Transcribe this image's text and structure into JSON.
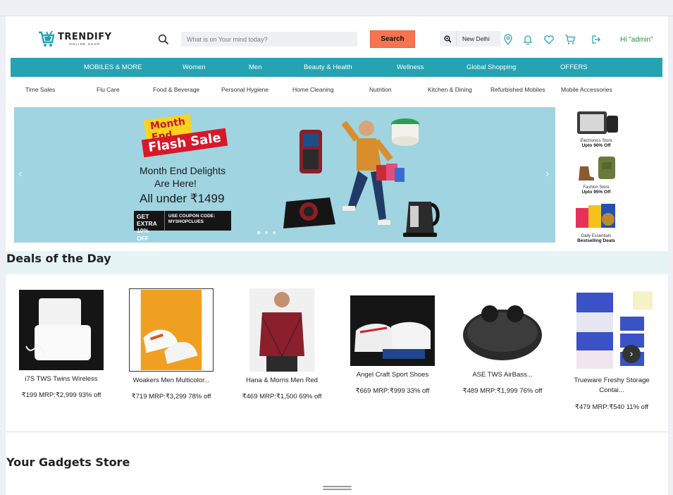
{
  "header": {
    "brand": "TRENDIFY",
    "brand_tagline": "ONLINE SHOP",
    "search_placeholder": "What is on Your mind today?",
    "search_button": "Search",
    "location": "New Delhi",
    "greeting": "Hi \"admin\""
  },
  "nav": {
    "items": [
      "MOBILES & MORE",
      "Women",
      "Men",
      "Beauty & Health",
      "Wellness",
      "Global Shopping",
      "OFFERS"
    ]
  },
  "subcategories": [
    "Time Sales",
    "Flu Care",
    "Food & Beverage",
    "Personal Hygiene",
    "Home Cleaning",
    "Nutrition",
    "Kitchen & Dining",
    "Refurbished Mobiles",
    "Mobile Accessories"
  ],
  "banner": {
    "flash_top": "Month End",
    "flash_bottom": "Flash Sale",
    "line1": "Month End Delights",
    "line2": "Are Here!",
    "line3": "All under ₹1499",
    "coupon_left": "GET EXTRA 10% OFF",
    "coupon_right": "USE COUPON CODE: MYSHOPCLUES"
  },
  "side_promos": [
    {
      "label": "Electronics Store",
      "sub": "Upto 90% Off"
    },
    {
      "label": "Fashion Store",
      "sub": "Upto 95% Off"
    },
    {
      "label": "Daily Essentials",
      "sub": "Bestselling Deals"
    }
  ],
  "deals": {
    "title": "Deals of the Day",
    "products": [
      {
        "name": "i7S TWS Twins Wireless",
        "price": "₹199 MRP:₹2,999 93% off"
      },
      {
        "name": "Woakers Men Multicolor...",
        "price": "₹719 MRP:₹3,299 78% off"
      },
      {
        "name": "Hana & Morris Men Red",
        "price": "₹469 MRP:₹1,500 69% off"
      },
      {
        "name": "Angel Craft Sport Shoes",
        "price": "₹669 MRP:₹999 33% off"
      },
      {
        "name": "ASE TWS AirBass...",
        "price": "₹489 MRP:₹1,999 76% off"
      },
      {
        "name": "Trueware Freshy Storage Contai...",
        "price": "₹479 MRP:₹540 11% off"
      }
    ]
  },
  "gadgets": {
    "title": "Your Gadgets Store"
  },
  "colors": {
    "nav_bg": "#26a3b2",
    "search_btn": "#f6744f",
    "banner_bg": "#9fd4e0",
    "deals_band": "#e6f4f6",
    "greeting": "#2a8a3a"
  }
}
